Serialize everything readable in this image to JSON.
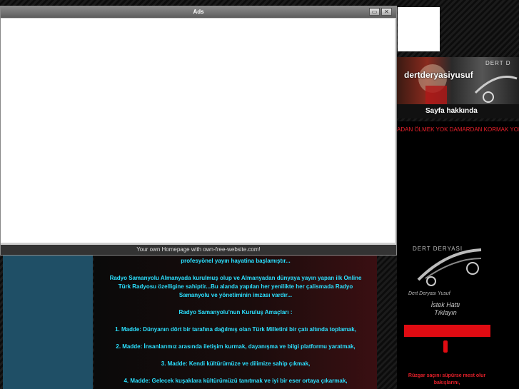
{
  "ads_window": {
    "title": "Ads",
    "footer_text": "Your own Homepage with own-free-website.com!",
    "minimize_glyph": "▭",
    "close_glyph": "✕"
  },
  "content": {
    "lines": [
      "profesyönel yayın hayatina başlamıştır...",
      "",
      "Radyo Samanyolu Almanyada kurulmuş olup ve Almanyadan dünyaya yayın yapan ilk Online",
      "Türk Radyosu özelligine sahiptir...Bu alanda yapılan her yenilikte her çalismada Radyo",
      "Samanyolu ve yönetiminin imzası vardır...",
      "",
      "Radyo Samanyolu'nun Kuruluş Amaçları :",
      "",
      "1. Madde: Dünyanın dört bir tarafına dağılmış olan Türk Milletini bir çatı altında toplamak,",
      "",
      "2. Madde: İnsanlarımız arasında iletişim kurmak, dayanışma ve bilgi platformu yaratmak,",
      "",
      "3. Madde: Kendi kültürümüze ve dilimize sahip çıkmak,",
      "",
      "4. Madde: Gelecek kuşaklara kültürümüzü tanıtmak ve iyi bir eser ortaya çıkarmak,"
    ]
  },
  "sidebar": {
    "profile_name": "dertderyasiyusuf",
    "banner_tag": "DERT D",
    "about_label": "Sayfa hakkında",
    "marquee_text": "ADAN ÖLMEK YOK DAMARDAN KORMAK YOK",
    "logo_title": "DERT DERYASI",
    "logo_subtitle": "Dert Deryası Yusuf",
    "request_line1": "İstek Hattı",
    "request_line2": "Tıklayın",
    "bottom_text_line1": "Rüzgar saçını süpürse mest olur",
    "bottom_text_line2": "bakışlarını,"
  },
  "colors": {
    "accent_cyan": "#2be0ff",
    "accent_red": "#e00b12",
    "left_panel": "#1f4f66"
  }
}
